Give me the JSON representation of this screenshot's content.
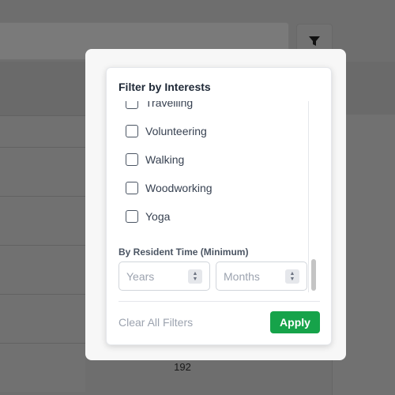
{
  "background": {
    "table_value": "192"
  },
  "filter_panel": {
    "title": "Filter by Interests",
    "options": [
      {
        "label": "Travelling",
        "checked": false
      },
      {
        "label": "Volunteering",
        "checked": false
      },
      {
        "label": "Walking",
        "checked": false
      },
      {
        "label": "Woodworking",
        "checked": false
      },
      {
        "label": "Yoga",
        "checked": false
      }
    ],
    "resident_time": {
      "label": "By Resident Time (Minimum)",
      "years_placeholder": "Years",
      "months_placeholder": "Months"
    },
    "clear_label": "Clear All Filters",
    "apply_label": "Apply"
  },
  "colors": {
    "accent": "#16a34a",
    "overlay": "#6e6e6e"
  },
  "icons": {
    "filter_button": "funnel-icon"
  }
}
